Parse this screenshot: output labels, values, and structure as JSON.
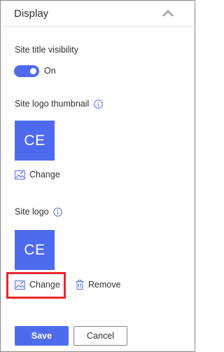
{
  "panel": {
    "title": "Display"
  },
  "site_title_visibility": {
    "label": "Site title visibility",
    "toggle_state": "On",
    "enabled": true
  },
  "site_logo_thumbnail": {
    "label": "Site logo thumbnail",
    "initials": "CE",
    "change_label": "Change"
  },
  "site_logo": {
    "label": "Site logo",
    "initials": "CE",
    "change_label": "Change",
    "remove_label": "Remove"
  },
  "footer": {
    "save_label": "Save",
    "cancel_label": "Cancel"
  },
  "colors": {
    "accent": "#4f6bed",
    "highlight": "#e8262c"
  }
}
